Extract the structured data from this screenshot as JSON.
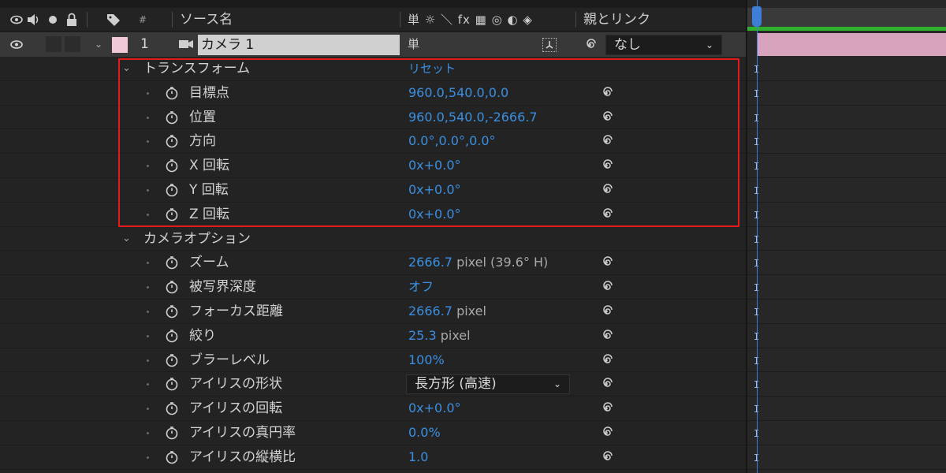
{
  "header": {
    "hash": "#",
    "source_name": "ソース名",
    "switch_icons": "単 ☼ ＼ fx ▦ ◎ ◐ ◈",
    "parent_link": "親とリンク"
  },
  "layer": {
    "number": "1",
    "name": "カメラ 1",
    "switch_symbol": "単",
    "parent": "なし"
  },
  "transform": {
    "label": "トランスフォーム",
    "reset": "リセット",
    "properties": [
      {
        "label": "目標点",
        "value": "960.0,540.0,0.0"
      },
      {
        "label": "位置",
        "value": "960.0,540.0,-2666.7"
      },
      {
        "label": "方向",
        "value": "0.0°,0.0°,0.0°"
      },
      {
        "label": "X 回転",
        "value": "0x+0.0°"
      },
      {
        "label": "Y 回転",
        "value": "0x+0.0°"
      },
      {
        "label": "Z 回転",
        "value": "0x+0.0°"
      }
    ]
  },
  "camera_options": {
    "label": "カメラオプション",
    "properties": [
      {
        "label": "ズーム",
        "value": "2666.7",
        "unit": "pixel (39.6° H)"
      },
      {
        "label": "被写界深度",
        "value": "オフ",
        "unit": ""
      },
      {
        "label": "フォーカス距離",
        "value": "2666.7",
        "unit": "pixel"
      },
      {
        "label": "絞り",
        "value": "25.3",
        "unit": "pixel"
      },
      {
        "label": "ブラーレベル",
        "value": "100%",
        "unit": ""
      },
      {
        "label": "アイリスの形状",
        "value": "長方形 (高速)",
        "unit": ""
      },
      {
        "label": "アイリスの回転",
        "value": "0x+0.0°",
        "unit": ""
      },
      {
        "label": "アイリスの真円率",
        "value": "0.0%",
        "unit": ""
      },
      {
        "label": "アイリスの縦横比",
        "value": "1.0",
        "unit": ""
      }
    ]
  },
  "colors": {
    "value_blue": "#3b8fe0",
    "highlight_red": "#e21a1a",
    "layer_label": "#f0c8d8",
    "layer_bar": "#d8a4bd",
    "work_area": "#2fb02f",
    "playhead": "#3d7fd8"
  }
}
